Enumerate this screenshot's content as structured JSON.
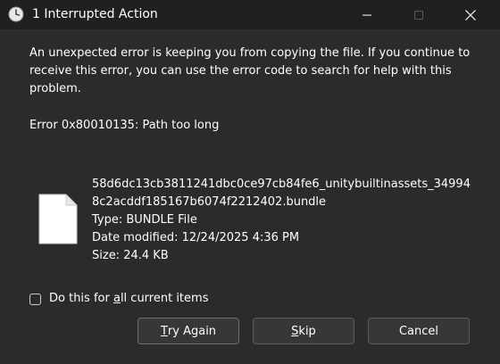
{
  "window": {
    "title": "1 Interrupted Action"
  },
  "message": {
    "text": "An unexpected error is keeping you from copying the file. If you continue to receive this error, you can use the error code to search for help with this problem.",
    "error": "Error 0x80010135: Path too long"
  },
  "file": {
    "name_line1": "58d6dc13cb3811241dbc0ce97cb84fe6_unitybuiltinassets_34994",
    "name_line2": "8c2acddf185167b6074f2212402.bundle",
    "type": "Type: BUNDLE File",
    "date_modified": "Date modified: 12/24/2025 4:36 PM",
    "size": "Size: 24.4 KB"
  },
  "checkbox": {
    "label_before": "Do this for ",
    "label_mnemonic": "a",
    "label_after": "ll current items",
    "checked": false
  },
  "buttons": {
    "try_again_mnemonic": "T",
    "try_again_rest": "ry Again",
    "skip_mnemonic": "S",
    "skip_rest": "kip",
    "cancel": "Cancel"
  },
  "icons": {
    "title": "clock-icon",
    "file": "file-icon",
    "minimize": "minimize-icon",
    "maximize": "maximize-icon",
    "close": "close-icon"
  },
  "colors": {
    "background": "#2b2b2b",
    "titlebar": "#202020",
    "button": "#373737",
    "text": "#ffffff"
  }
}
